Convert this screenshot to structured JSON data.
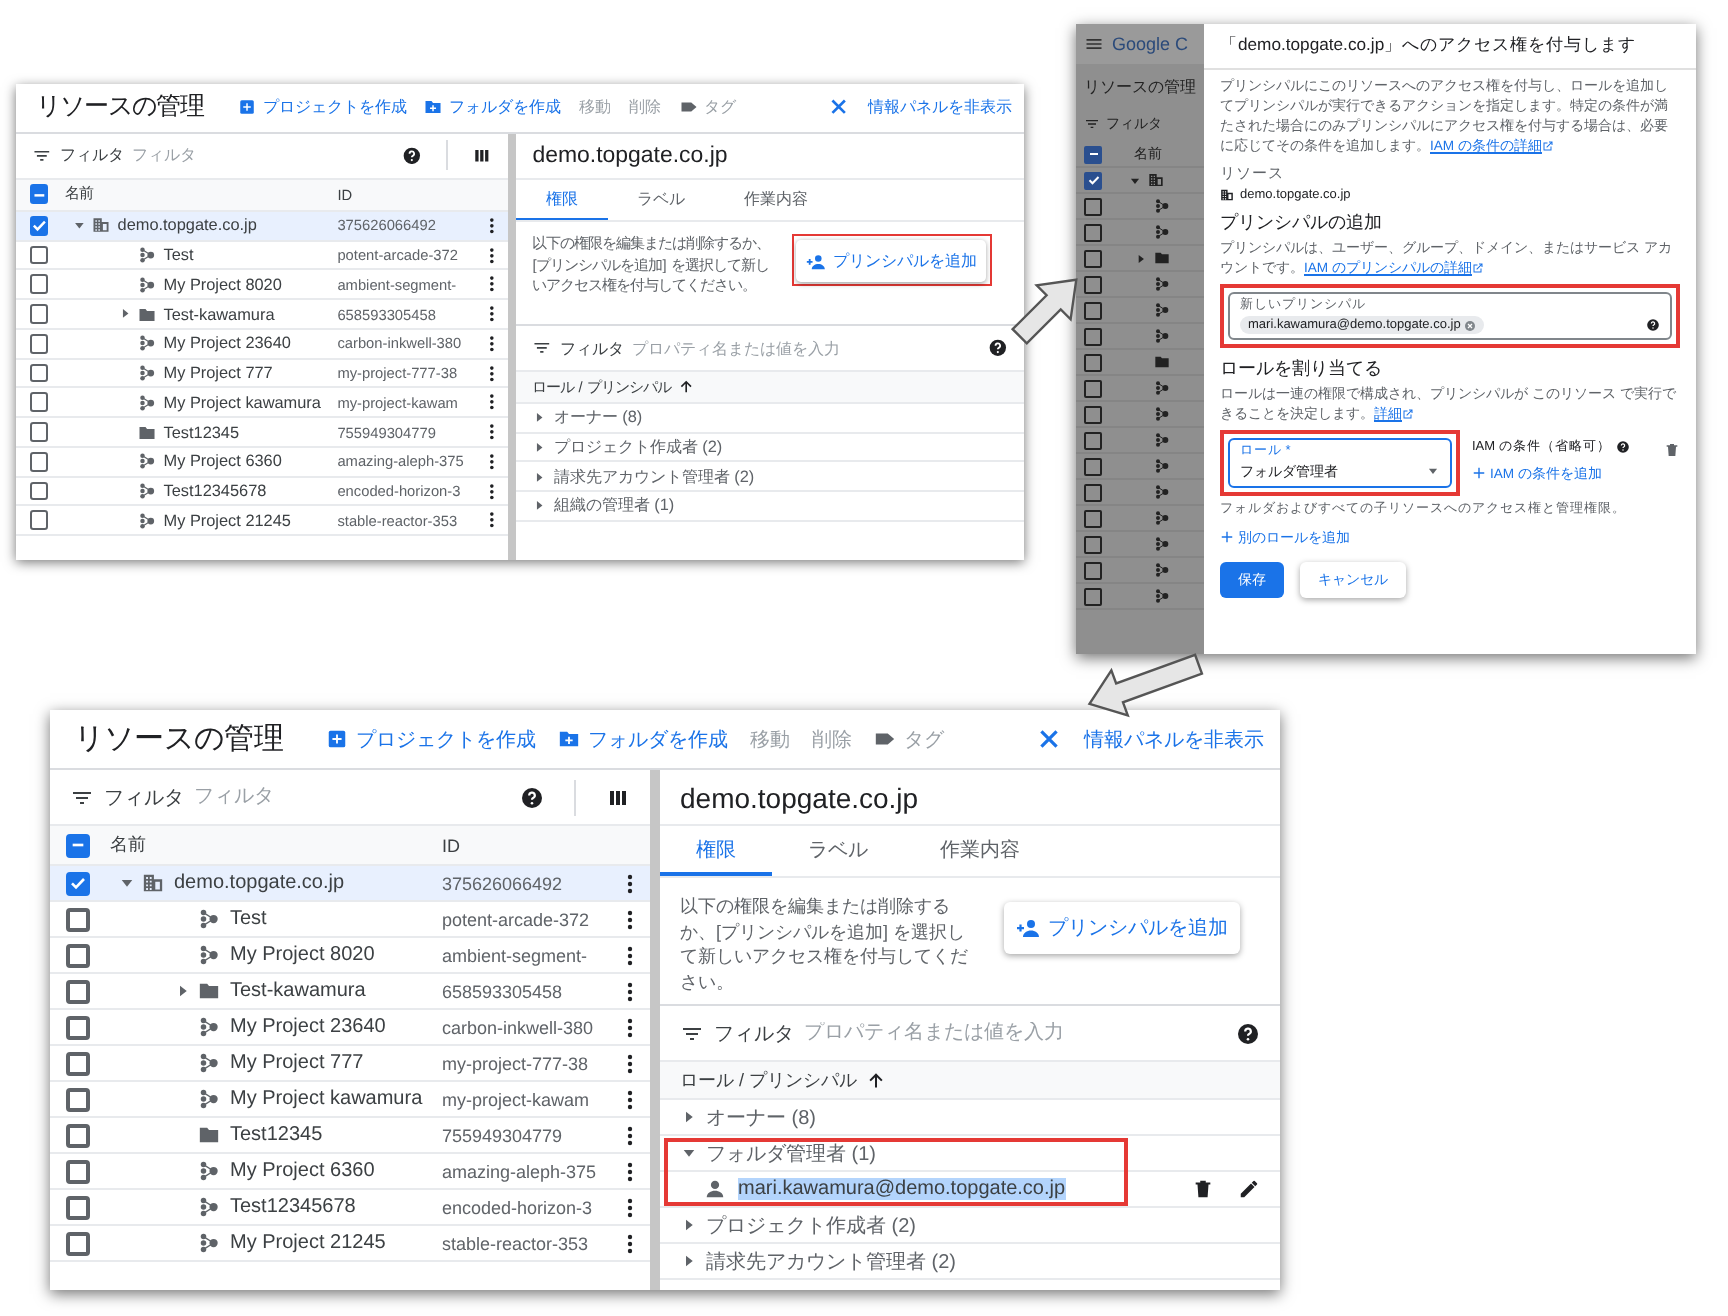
{
  "screens": [
    {
      "kind": "manager",
      "title": "リソースの管理",
      "actions": [
        {
          "label": "プロジェクトを作成",
          "kind": "create-project",
          "enabled": true
        },
        {
          "label": "フォルダを作成",
          "kind": "create-folder",
          "enabled": true
        },
        {
          "label": "移動",
          "kind": "plain",
          "enabled": false
        },
        {
          "label": "削除",
          "kind": "plain",
          "enabled": false
        },
        {
          "label": "タグ",
          "kind": "tag",
          "enabled": false
        }
      ],
      "hide_panel": "情報パネルを非表示",
      "filter": {
        "label": "フィルタ",
        "placeholder": "フィルタ"
      },
      "select_all": {
        "checked": true,
        "indeterminate": true
      },
      "columns": [
        "名前",
        "ID"
      ],
      "rows": [
        {
          "name": "demo.topgate.co.jp",
          "id": "375626066492",
          "kind": "organization",
          "checked": true,
          "selected": true,
          "expanded": true,
          "children": [
            {
              "name": "Test",
              "id": "potent-arcade-372",
              "kind": "project",
              "checked": false,
              "selected": false
            },
            {
              "name": "My Project 8020",
              "id": "ambient-segment-",
              "kind": "project",
              "checked": false,
              "selected": false
            },
            {
              "name": "Test-kawamura",
              "id": "658593305458",
              "kind": "folder",
              "checked": false,
              "selected": false,
              "expanded": false
            },
            {
              "name": "My Project 23640",
              "id": "carbon-inkwell-380",
              "kind": "project",
              "checked": false,
              "selected": false
            },
            {
              "name": "My Project 777",
              "id": "my-project-777-38",
              "kind": "project",
              "checked": false,
              "selected": false
            },
            {
              "name": "My Project kawamura",
              "id": "my-project-kawam",
              "kind": "project",
              "checked": false,
              "selected": false
            },
            {
              "name": "Test12345",
              "id": "755949304779",
              "kind": "folder",
              "checked": false,
              "selected": false
            },
            {
              "name": "My Project 6360",
              "id": "amazing-aleph-375",
              "kind": "project",
              "checked": false,
              "selected": false
            },
            {
              "name": "Test12345678",
              "id": "encoded-horizon-3",
              "kind": "project",
              "checked": false,
              "selected": false
            },
            {
              "name": "My Project 21245",
              "id": "stable-reactor-353",
              "kind": "project",
              "checked": false,
              "selected": false
            }
          ]
        }
      ],
      "details": {
        "title": "demo.topgate.co.jp",
        "tabs": [
          {
            "label": "権限",
            "selected": true
          },
          {
            "label": "ラベル",
            "selected": false
          },
          {
            "label": "作業内容",
            "selected": false
          }
        ],
        "description": "以下の権限を編集または削除するか、[プリンシパルを追加] を選択して新しいアクセス権を付与してください。",
        "add_button": {
          "label": "プリンシパルを追加",
          "highlighted": true
        },
        "filter": {
          "label": "フィルタ",
          "placeholder": "プロパティ名または値を入力"
        },
        "column": "ロール / プリンシパル",
        "roles": [
          {
            "label": "オーナー (8)",
            "expanded": false
          },
          {
            "label": "プロジェクト作成者 (2)",
            "expanded": false
          },
          {
            "label": "請求先アカウント管理者 (2)",
            "expanded": false
          },
          {
            "label": "組織の管理者 (1)",
            "expanded": false
          }
        ]
      }
    },
    {
      "kind": "dialog",
      "backdrop": {
        "brand": "Google C",
        "title": "リソースの管理",
        "filter": "フィルタ",
        "column": "名前",
        "select_all": {
          "checked": true,
          "indeterminate": true
        },
        "rows": [
          {
            "kind": "organization",
            "checked": true,
            "expanded": true
          },
          {
            "kind": "project",
            "checked": false
          },
          {
            "kind": "project",
            "checked": false
          },
          {
            "kind": "folder",
            "checked": false,
            "expanded": false
          },
          {
            "kind": "project",
            "checked": false
          },
          {
            "kind": "project",
            "checked": false
          },
          {
            "kind": "project",
            "checked": false
          },
          {
            "kind": "folder",
            "checked": false
          },
          {
            "kind": "project",
            "checked": false
          },
          {
            "kind": "project",
            "checked": false
          },
          {
            "kind": "project",
            "checked": false
          },
          {
            "kind": "project",
            "checked": false
          },
          {
            "kind": "project",
            "checked": false
          },
          {
            "kind": "project",
            "checked": false
          },
          {
            "kind": "project",
            "checked": false
          },
          {
            "kind": "project",
            "checked": false
          },
          {
            "kind": "project",
            "checked": false
          }
        ]
      },
      "title": "「demo.topgate.co.jp」へのアクセス権を付与します",
      "intro": "プリンシパルにこのリソースへのアクセス権を付与し、ロールを追加してプリンシパルが実行できるアクションを指定します。特定の条件が満たされた場合にのみプリンシパルにアクセス権を付与する場合は、必要に応じてその条件を追加します。",
      "intro_link": "IAM の条件の詳細",
      "resource_heading": "リソース",
      "resource": "demo.topgate.co.jp",
      "principal_heading": "プリンシパルの追加",
      "principal_text": "プリンシパルは、ユーザー、グループ、ドメイン、またはサービス アカウントです。",
      "principal_link": "IAM のプリンシパルの詳細",
      "principal_field": {
        "label": "新しいプリンシパル",
        "chips": [
          "mari.kawamura@demo.topgate.co.jp"
        ],
        "highlighted": true
      },
      "role_heading": "ロールを割り当てる",
      "role_text": "ロールは一連の権限で構成され、プリンシパルが このリソース で実行できることを決定します。",
      "role_link": "詳細",
      "roles": [
        {
          "label": "ロール *",
          "value": "フォルダ管理者",
          "hint": "フォルダおよびすべての子リソースへのアクセス権と管理権限。",
          "highlighted": true,
          "condition_label": "IAM の条件（省略可）",
          "condition_link": "IAM の条件を追加"
        }
      ],
      "add_role": "別のロールを追加",
      "buttons": [
        {
          "label": "保存",
          "kind": "primary"
        },
        {
          "label": "キャンセル",
          "kind": "secondary"
        }
      ]
    },
    {
      "kind": "manager",
      "title": "リソースの管理",
      "actions": [
        {
          "label": "プロジェクトを作成",
          "kind": "create-project",
          "enabled": true
        },
        {
          "label": "フォルダを作成",
          "kind": "create-folder",
          "enabled": true
        },
        {
          "label": "移動",
          "kind": "plain",
          "enabled": false
        },
        {
          "label": "削除",
          "kind": "plain",
          "enabled": false
        },
        {
          "label": "タグ",
          "kind": "tag",
          "enabled": false
        }
      ],
      "hide_panel": "情報パネルを非表示",
      "filter": {
        "label": "フィルタ",
        "placeholder": "フィルタ"
      },
      "select_all": {
        "checked": true,
        "indeterminate": true
      },
      "columns": [
        "名前",
        "ID"
      ],
      "rows": [
        {
          "name": "demo.topgate.co.jp",
          "id": "375626066492",
          "kind": "organization",
          "checked": true,
          "selected": true,
          "expanded": true,
          "children": [
            {
              "name": "Test",
              "id": "potent-arcade-372",
              "kind": "project",
              "checked": false,
              "selected": false
            },
            {
              "name": "My Project 8020",
              "id": "ambient-segment-",
              "kind": "project",
              "checked": false,
              "selected": false
            },
            {
              "name": "Test-kawamura",
              "id": "658593305458",
              "kind": "folder",
              "checked": false,
              "selected": false,
              "expanded": false
            },
            {
              "name": "My Project 23640",
              "id": "carbon-inkwell-380",
              "kind": "project",
              "checked": false,
              "selected": false
            },
            {
              "name": "My Project 777",
              "id": "my-project-777-38",
              "kind": "project",
              "checked": false,
              "selected": false
            },
            {
              "name": "My Project kawamura",
              "id": "my-project-kawam",
              "kind": "project",
              "checked": false,
              "selected": false
            },
            {
              "name": "Test12345",
              "id": "755949304779",
              "kind": "folder",
              "checked": false,
              "selected": false
            },
            {
              "name": "My Project 6360",
              "id": "amazing-aleph-375",
              "kind": "project",
              "checked": false,
              "selected": false
            },
            {
              "name": "Test12345678",
              "id": "encoded-horizon-3",
              "kind": "project",
              "checked": false,
              "selected": false
            },
            {
              "name": "My Project 21245",
              "id": "stable-reactor-353",
              "kind": "project",
              "checked": false,
              "selected": false
            }
          ]
        }
      ],
      "details": {
        "title": "demo.topgate.co.jp",
        "tabs": [
          {
            "label": "権限",
            "selected": true
          },
          {
            "label": "ラベル",
            "selected": false
          },
          {
            "label": "作業内容",
            "selected": false
          }
        ],
        "description": "以下の権限を編集または削除するか、[プリンシパルを追加] を選択して新しいアクセス権を付与してください。",
        "add_button": {
          "label": "プリンシパルを追加"
        },
        "filter": {
          "label": "フィルタ",
          "placeholder": "プロパティ名または値を入力"
        },
        "column": "ロール / プリンシパル",
        "roles": [
          {
            "label": "オーナー (8)",
            "expanded": false
          },
          {
            "label": "フォルダ管理者 (1)",
            "expanded": true,
            "highlighted": true,
            "members": [
              {
                "email": "mari.kawamura@demo.topgate.co.jp",
                "selected": true
              }
            ]
          },
          {
            "label": "プロジェクト作成者 (2)",
            "expanded": false
          },
          {
            "label": "請求先アカウント管理者 (2)",
            "expanded": false
          }
        ]
      }
    }
  ]
}
